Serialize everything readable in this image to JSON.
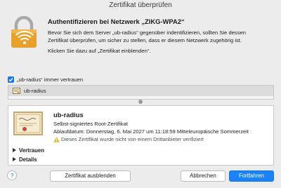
{
  "window": {
    "title": "Zertifikat überprüfen"
  },
  "dialog": {
    "heading": "Authentifizieren bei Netzwerk „ZIKG-WPA2“",
    "body_line1": "Bevor Sie sich dem Server „ub-radius“ gegenüber indentifizieren, sollten Sie dessen",
    "body_line2": "Zertifikat überprüfen, um sicher zu stellen, dass er diesem Netzwerk zugehörig ist.",
    "body_line3": "Klicken Sie dazu auf „Zertifikat einblenden“."
  },
  "trust_checkbox": {
    "label": "„ub-radius“ immer vertrauen",
    "checked": true
  },
  "chain": {
    "items": [
      {
        "label": "ub-radius",
        "icon": "certificate-icon"
      }
    ]
  },
  "certificate": {
    "name": "ub-radius",
    "type": "Selbst-signiertes Root-Zertifikat",
    "expiry": "Ablaufdatum: Donnerstag, 6. Mai 2027 um 11:18:59 Mitteleuropäische Sommerzeit",
    "warning": "Dieses Zertifikat wurde nicht von einem Drittanbieter verifiziert",
    "sections": [
      "Vertrauen",
      "Details"
    ]
  },
  "buttons": {
    "help": "?",
    "hide_certificate": "Zertifikat ausblenden",
    "cancel": "Abbrechen",
    "continue": "Fortfahren"
  },
  "colors": {
    "accent": "#1b82f7",
    "lock": "#e8a12b",
    "warning": "#f2b705"
  }
}
